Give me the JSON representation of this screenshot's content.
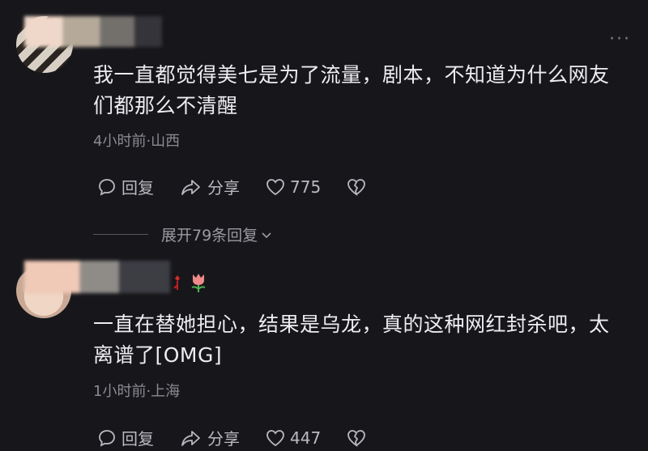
{
  "comments": [
    {
      "text_line1": "我一直都觉得美七是为了流量，剧本，不知道为什么网友",
      "text_line2": "们都那么不清醒",
      "meta": "4小时前·山西",
      "reply_label": "回复",
      "share_label": "分享",
      "likes": "775",
      "expand_label": "展开79条回复"
    },
    {
      "text_line1": "一直在替她担心，结果是乌龙，真的这种网红封杀吧，太",
      "text_line2": "离谱了[OMG]",
      "meta": "1小时前·上海",
      "reply_label": "回复",
      "share_label": "分享",
      "likes": "447"
    }
  ],
  "colors": {
    "background": "#17171b",
    "text": "#ededf0",
    "meta": "#8a8a92",
    "action": "#b9b9c0"
  },
  "icons": [
    "more-icon",
    "reply-icon",
    "share-icon",
    "heart-icon",
    "broken-heart-icon",
    "chevron-down-icon",
    "tulip-icon",
    "rose-icon"
  ]
}
